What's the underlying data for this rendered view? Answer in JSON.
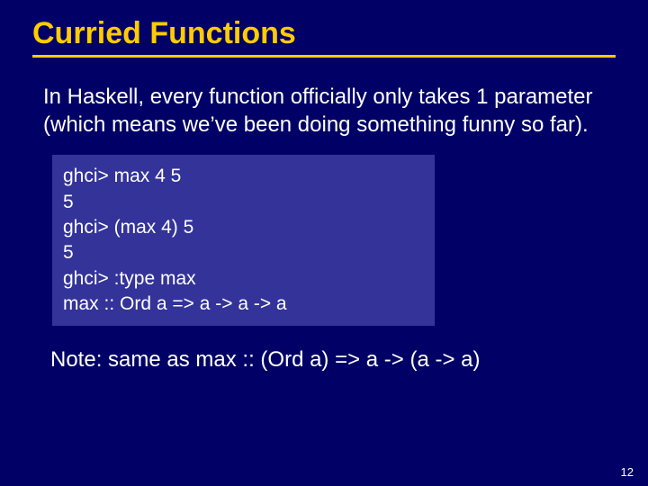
{
  "title": "Curried Functions",
  "body": "In Haskell, every function officially only takes 1 parameter (which means we’ve been doing something funny so far).",
  "code": {
    "l1": "ghci> max 4 5",
    "l2": "5",
    "l3": "ghci> (max 4) 5",
    "l4": "5",
    "l5": "ghci> :type max",
    "l6": "max :: Ord a => a -> a -> a"
  },
  "note": "Note: same as max :: (Ord a) => a -> (a -> a)",
  "page_number": "12"
}
